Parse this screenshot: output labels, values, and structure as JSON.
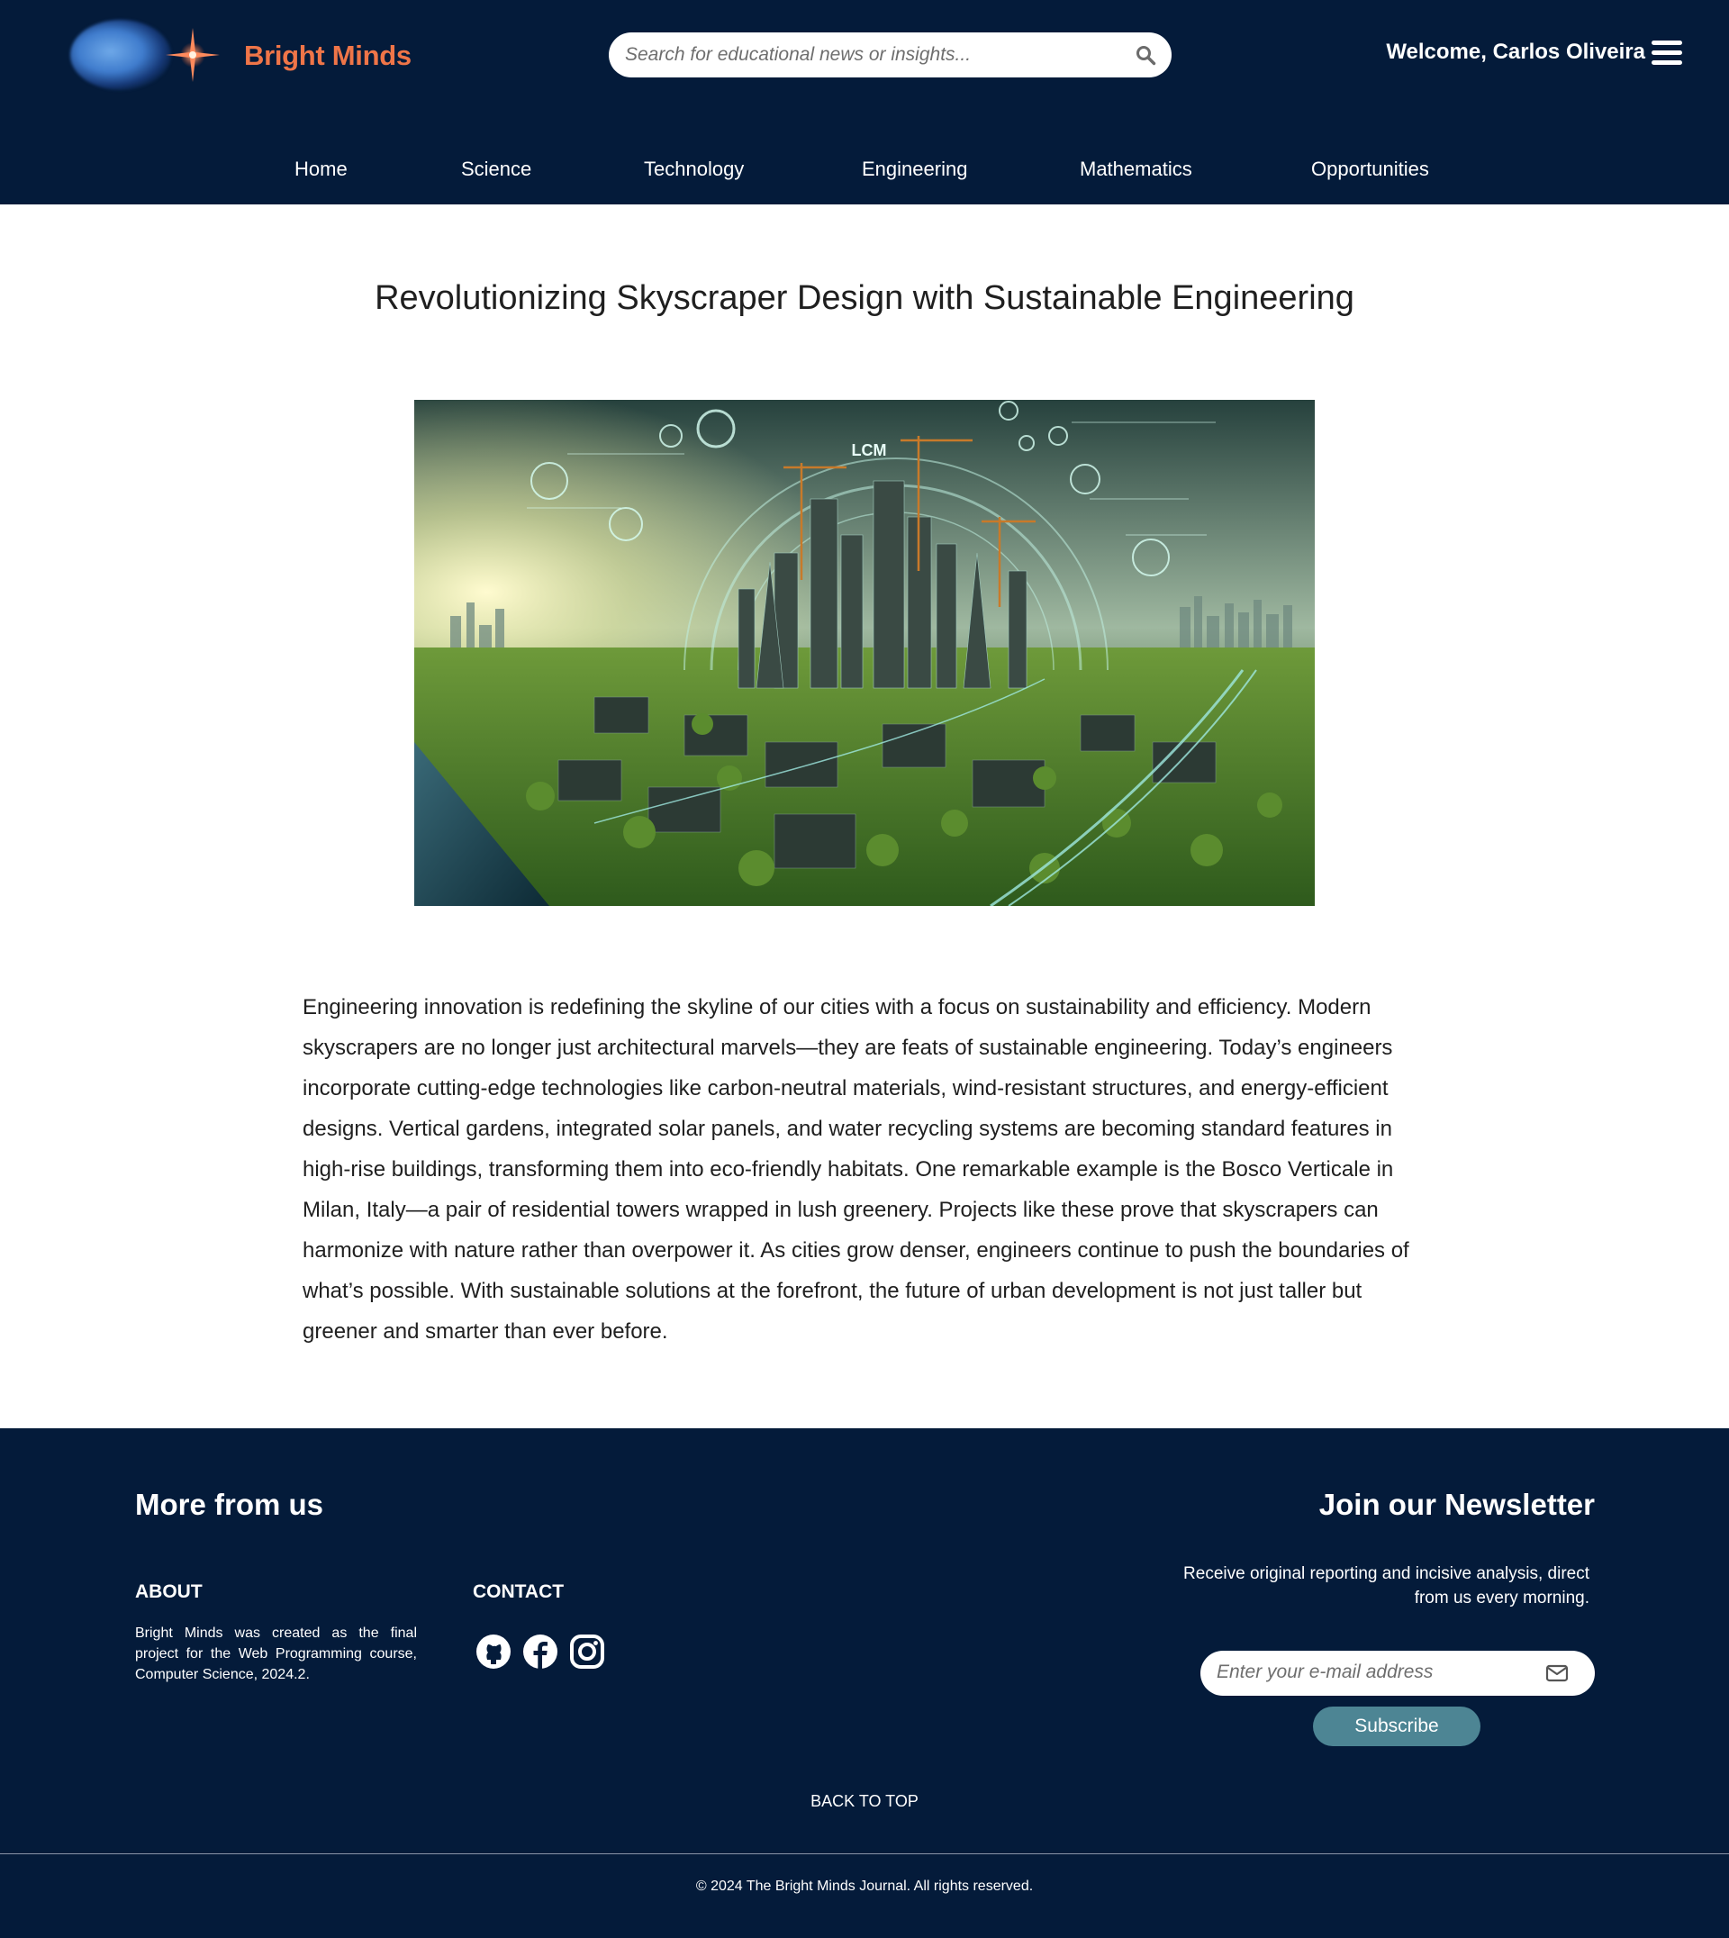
{
  "brand": {
    "name": "Bright Minds",
    "accent_color": "#ef7548",
    "header_bg": "#041b3a",
    "logo_icon": "sparkle-orb-logo"
  },
  "search": {
    "placeholder": "Search for educational news or insights...",
    "icon": "search-icon"
  },
  "user": {
    "welcome": "Welcome, Carlos Oliveira",
    "menu_icon": "hamburger-menu-icon"
  },
  "nav": {
    "items": [
      {
        "label": "Home"
      },
      {
        "label": "Science"
      },
      {
        "label": "Technology"
      },
      {
        "label": "Engineering"
      },
      {
        "label": "Mathematics"
      },
      {
        "label": "Opportunities"
      }
    ]
  },
  "article": {
    "title": "Revolutionizing Skyscraper Design with Sustainable Engineering",
    "image_label": "LCM",
    "body": "Engineering innovation is redefining the skyline of our cities with a focus on sustainability and efficiency. Modern skyscrapers are no longer just architectural marvels—they are feats of sustainable engineering. Today’s engineers incorporate cutting-edge technologies like carbon-neutral materials, wind-resistant structures, and energy-efficient designs. Vertical gardens, integrated solar panels, and water recycling systems are becoming standard features in high-rise buildings, transforming them into eco-friendly habitats. One remarkable example is the Bosco Verticale in Milan, Italy—a pair of residential towers wrapped in lush greenery. Projects like these prove that skyscrapers can harmonize with nature rather than overpower it. As cities grow denser, engineers continue to push the boundaries of what’s possible. With sustainable solutions at the forefront, the future of urban development is not just taller but greener and smarter than ever before."
  },
  "footer": {
    "more_title": "More from us",
    "about": {
      "heading": "ABOUT",
      "text": "Bright Minds was created as the final project for the Web Programming course, Computer Science, 2024.2."
    },
    "contact": {
      "heading": "CONTACT",
      "icons": [
        "github-icon",
        "facebook-icon",
        "instagram-icon"
      ]
    },
    "newsletter": {
      "title": "Join our Newsletter",
      "text": "Receive original reporting and incisive analysis, direct from us every morning.",
      "email_placeholder": "Enter your e-mail address",
      "email_icon": "envelope-icon",
      "subscribe_label": "Subscribe",
      "button_color": "#4d8594"
    },
    "back_to_top": "BACK TO TOP",
    "copyright": "© 2024 The Bright Minds Journal. All rights reserved."
  }
}
